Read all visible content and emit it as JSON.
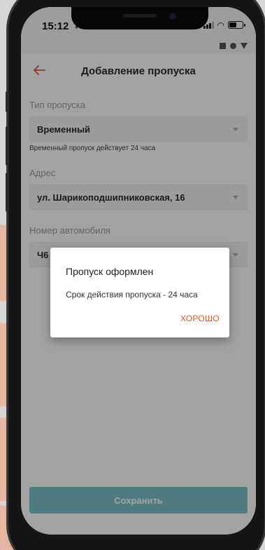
{
  "status_bar": {
    "time": "15:12",
    "navigation_glyph": "➶"
  },
  "system_strip": {
    "icons": [
      "square-icon",
      "circle-icon",
      "triangle-icon"
    ]
  },
  "header": {
    "back_icon": "arrow-left-icon",
    "title": "Добавление пропуска"
  },
  "form": {
    "pass_type": {
      "label": "Тип пропуска",
      "value": "Временный",
      "hint": "Временный пропуск действует 24 часа"
    },
    "address": {
      "label": "Адрес",
      "value": "ул. Шарикоподшипниковская, 16"
    },
    "car_number": {
      "label": "Номер автомобиля",
      "value": "Ч6"
    }
  },
  "save_button": {
    "label": "Сохранить"
  },
  "dialog": {
    "title": "Пропуск оформлен",
    "message": "Срок действия пропуска - 24 часа",
    "ok_label": "ХОРОШО"
  },
  "colors": {
    "accent": "#e8562e",
    "save_button": "#7fc2c7",
    "text_dark": "#2b2b2b",
    "label_gray": "#9a9a9a"
  }
}
